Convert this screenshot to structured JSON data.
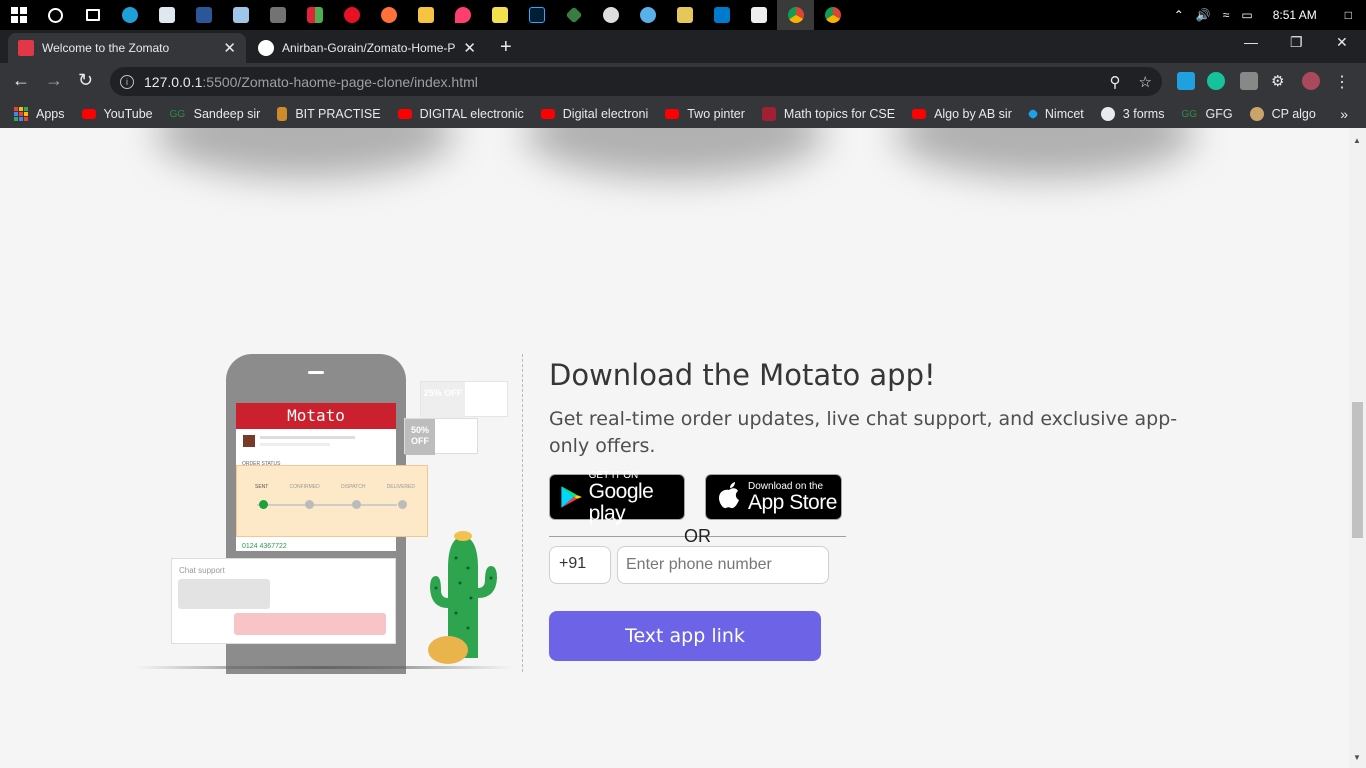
{
  "taskbar": {
    "time": "8:51 AM",
    "icons": [
      "windows-start-icon",
      "cortana-icon",
      "task-view-icon",
      "edge-icon",
      "photos-icon",
      "word-icon",
      "notepad-icon",
      "calculator-icon",
      "apps-icon",
      "target-icon",
      "firefox-icon",
      "file-explorer-icon",
      "paint-icon",
      "sticky-notes-icon",
      "photoshop-icon",
      "git-icon",
      "clock-icon",
      "paint3d-icon",
      "snip-icon",
      "vscode-icon",
      "feedback-icon",
      "chrome-icon",
      "chrome-icon-2"
    ],
    "tray_icons": [
      "chevron-up-icon",
      "volume-icon",
      "wifi-icon",
      "battery-icon",
      "notification-icon"
    ]
  },
  "tabs": [
    {
      "title": "Welcome to the Zomato",
      "active": true,
      "favicon_color": "#e23744"
    },
    {
      "title": "Anirban-Gorain/Zomato-Home-P",
      "active": false,
      "favicon_color": "#ffffff"
    }
  ],
  "toolbar": {
    "url_host": "127.0.0.1",
    "url_path": ":5500/Zomato-haome-page-clone/index.html"
  },
  "bookmarks": [
    {
      "label": "Apps",
      "icon": "apps-grid-icon"
    },
    {
      "label": "YouTube",
      "icon": "youtube-icon"
    },
    {
      "label": "Sandeep sir",
      "icon": "gfg-icon"
    },
    {
      "label": "BIT PRACTISE",
      "icon": "bit-icon"
    },
    {
      "label": "DIGITAL electronic",
      "icon": "youtube-icon"
    },
    {
      "label": "Digital electroni",
      "icon": "youtube-icon"
    },
    {
      "label": "Two pinter",
      "icon": "youtube-icon"
    },
    {
      "label": "Math topics for CSE",
      "icon": "mit-ocw-icon"
    },
    {
      "label": "Algo by AB sir",
      "icon": "youtube-icon"
    },
    {
      "label": "Nimcet",
      "icon": "nimcet-icon"
    },
    {
      "label": "3 forms",
      "icon": "forms-icon"
    },
    {
      "label": "GFG",
      "icon": "gfg-icon"
    },
    {
      "label": "CP algo",
      "icon": "cp-algo-icon"
    }
  ],
  "illustration": {
    "app_name": "Motato",
    "offer_1": "50% OFF",
    "offer_2": "25% OFF",
    "order_status_label": "ORDER STATUS",
    "steps": [
      "SENT",
      "CONFIRMED",
      "DISPATCH",
      "DELIVERED"
    ],
    "phone_number": "0124 4367722",
    "chat_label": "Chat support"
  },
  "main": {
    "title": "Download the Motato app!",
    "subtitle": "Get real-time order updates, live chat support, and exclusive app-only offers.",
    "google_play": {
      "small": "GET IT ON",
      "big": "Google play"
    },
    "app_store": {
      "small": "Download on the",
      "big": "App Store"
    },
    "or_label": "OR",
    "country_code": "+91",
    "phone_placeholder": "Enter phone number",
    "cta_label": "Text app link"
  },
  "colors": {
    "accent": "#6c63e6",
    "brand_red": "#cb202d",
    "page_bg": "#f5f5f5"
  }
}
